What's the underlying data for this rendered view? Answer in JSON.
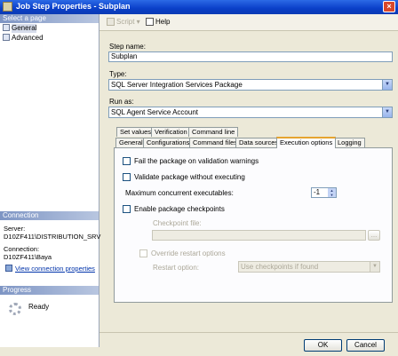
{
  "window": {
    "title": "Job Step Properties - Subplan",
    "close_glyph": "×"
  },
  "sidebar": {
    "header": "Select a page",
    "items": [
      {
        "label": "General"
      },
      {
        "label": "Advanced"
      }
    ],
    "connection": {
      "header": "Connection",
      "server_label": "Server:",
      "server_value": "D10ZF411\\DISTRIBUTION_SRV",
      "connection_label": "Connection:",
      "connection_value": "D10ZF411\\Baya",
      "link": "View connection properties"
    },
    "progress": {
      "header": "Progress",
      "status": "Ready"
    }
  },
  "toolbar": {
    "script_label": "Script",
    "help_label": "Help"
  },
  "form": {
    "step_name_label": "Step name:",
    "step_name_value": "Subplan",
    "type_label": "Type:",
    "type_value": "SQL Server Integration Services Package",
    "run_as_label": "Run as:",
    "run_as_value": "SQL Agent Service Account"
  },
  "tabs": {
    "row1": [
      "Set values",
      "Verification",
      "Command line"
    ],
    "row2": [
      "General",
      "Configurations",
      "Command files",
      "Data sources",
      "Execution options",
      "Logging"
    ],
    "active": "Execution options"
  },
  "exec_options": {
    "fail_on_warnings": "Fail the package on validation warnings",
    "validate_without_exec": "Validate package without executing",
    "max_concurrent_label": "Maximum concurrent executables:",
    "max_concurrent_value": "-1",
    "enable_checkpoints": "Enable package checkpoints",
    "checkpoint_file_label": "Checkpoint file:",
    "browse_label": "...",
    "override_restart": "Override restart options",
    "restart_option_label": "Restart option:",
    "restart_option_value": "Use checkpoints if found"
  },
  "footer": {
    "ok_label": "OK",
    "cancel_label": "Cancel"
  }
}
